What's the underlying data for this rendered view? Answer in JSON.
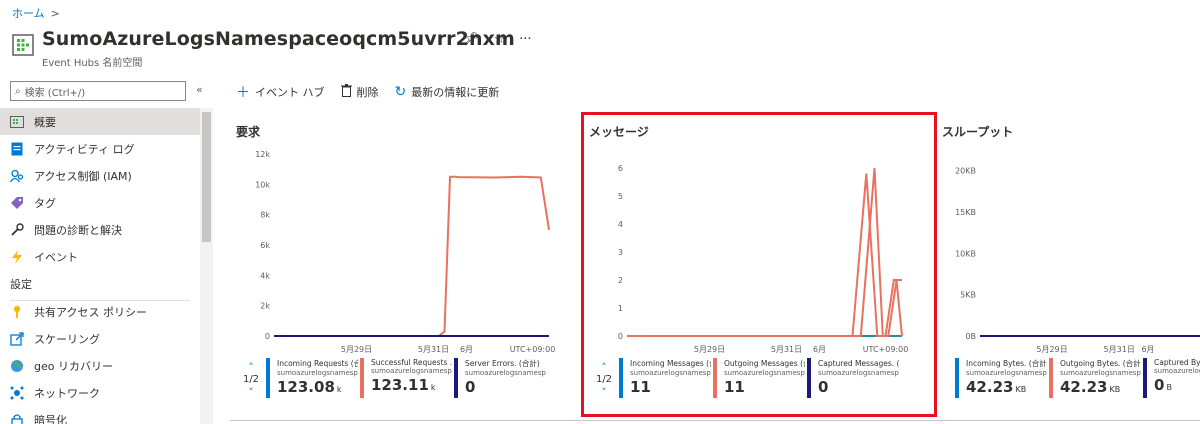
{
  "breadcrumb": {
    "home": "ホーム",
    "sep": ">"
  },
  "header": {
    "title": "SumoAzureLogsNamespaceoqcm5uvrr2nxm",
    "subtitle": "Event Hubs 名前空間",
    "pin": "✎",
    "star": "☆",
    "more": "···"
  },
  "sidebar": {
    "search_placeholder": "検索 (Ctrl+/)",
    "collapse": "«",
    "items": [
      {
        "label": "概要",
        "icon": "overview-icon"
      },
      {
        "label": "アクティビティ ログ",
        "icon": "activity-log-icon"
      },
      {
        "label": "アクセス制御 (IAM)",
        "icon": "iam-icon"
      },
      {
        "label": "タグ",
        "icon": "tag-icon"
      },
      {
        "label": "問題の診断と解決",
        "icon": "wrench-icon"
      },
      {
        "label": "イベント",
        "icon": "lightning-icon"
      }
    ],
    "section": "設定",
    "settings_items": [
      {
        "label": "共有アクセス ポリシー",
        "icon": "key-icon"
      },
      {
        "label": "スケーリング",
        "icon": "scale-icon"
      },
      {
        "label": "geo リカバリー",
        "icon": "globe-icon"
      },
      {
        "label": "ネットワーク",
        "icon": "network-icon"
      },
      {
        "label": "暗号化",
        "icon": "lock-icon"
      }
    ]
  },
  "toolbar": {
    "add_label": "イベント ハブ",
    "delete_label": "削除",
    "refresh_label": "最新の情報に更新"
  },
  "colors": {
    "accent": "#0078d4",
    "series_red": "#e8715f",
    "series_navy": "#1a1a7a",
    "series_teal": "#2a8a9a",
    "highlight": "#e81123"
  },
  "chart_data": [
    {
      "type": "line",
      "title": "要求",
      "x_ticks": [
        "5月29日",
        "5月31日",
        "6月",
        "UTC+09:00"
      ],
      "y_ticks": [
        "0",
        "2k",
        "4k",
        "6k",
        "8k",
        "10k",
        "12k"
      ],
      "ylim": [
        0,
        12000
      ],
      "series": [
        {
          "name": "Incoming Requests (合計)",
          "color": "#1a1a7a",
          "x": [
            0,
            62,
            63,
            64,
            67,
            100
          ],
          "y": [
            0,
            0,
            0,
            0,
            0,
            0
          ]
        },
        {
          "name": "Successful Requests (合計)",
          "color": "#e8715f",
          "x": [
            0,
            60,
            62,
            64,
            66,
            67,
            80,
            90,
            97,
            100
          ],
          "y": [
            0,
            0,
            300,
            10500,
            10500,
            10480,
            10450,
            10500,
            10450,
            7000
          ]
        },
        {
          "name": "Server Errors. (合計)",
          "color": "#1a1a7a",
          "x": [
            0,
            100
          ],
          "y": [
            0,
            0
          ]
        }
      ],
      "legend_page": "1/2",
      "legend": [
        {
          "l1": "Incoming Requests (合計)",
          "l2": "sumoazurelogsnamespa...",
          "value": "123.08",
          "unit": "k",
          "color": "#0078d4"
        },
        {
          "l1": "Successful Requests ...",
          "l2": "sumoazurelogsnamespa...",
          "value": "123.11",
          "unit": "k",
          "color": "#e8715f"
        },
        {
          "l1": "Server Errors. (合計)",
          "l2": "sumoazurelogsnamespa...",
          "value": "0",
          "unit": "",
          "color": "#1a1a7a"
        }
      ]
    },
    {
      "type": "line",
      "title": "メッセージ",
      "x_ticks": [
        "5月29日",
        "5月31日",
        "6月",
        "UTC+09:00"
      ],
      "y_ticks": [
        "0",
        "1",
        "2",
        "3",
        "4",
        "5",
        "6"
      ],
      "ylim": [
        0,
        6.5
      ],
      "series": [
        {
          "name": "Captured Messages. (合計)",
          "color": "#2a8a9a",
          "x": [
            0,
            100
          ],
          "y": [
            0,
            0
          ]
        },
        {
          "name": "Incoming Messages (合計)",
          "color": "#e8715f",
          "x": [
            0,
            80,
            85,
            90,
            93,
            95,
            98,
            100
          ],
          "y": [
            0,
            0,
            0,
            6,
            0,
            0,
            2,
            0
          ]
        },
        {
          "name": "Outgoing Messages (合計)",
          "color": "#e8715f",
          "x": [
            0,
            82,
            87,
            91,
            94,
            97,
            100
          ],
          "y": [
            0,
            0,
            5.8,
            0,
            0,
            2,
            2
          ]
        }
      ],
      "legend_page": "1/2",
      "legend": [
        {
          "l1": "Incoming Messages (合計)",
          "l2": "sumoazurelogsnamespa...",
          "value": "11",
          "unit": "",
          "color": "#0078d4"
        },
        {
          "l1": "Outgoing Messages (合計)",
          "l2": "sumoazurelogsnamespa...",
          "value": "11",
          "unit": "",
          "color": "#e8715f"
        },
        {
          "l1": "Captured Messages. (合計)",
          "l2": "sumoazurelogsnamespa...",
          "value": "0",
          "unit": "",
          "color": "#1a1a7a"
        }
      ]
    },
    {
      "type": "line",
      "title": "スループット",
      "x_ticks": [
        "5月29日",
        "5月31日",
        "6月"
      ],
      "y_ticks": [
        "0B",
        "5KB",
        "10KB",
        "15KB",
        "20KB"
      ],
      "ylim": [
        0,
        22000
      ],
      "series": [
        {
          "name": "Incoming Bytes. (合計)",
          "color": "#1a1a7a",
          "x": [
            0,
            100
          ],
          "y": [
            0,
            0
          ]
        }
      ],
      "legend": [
        {
          "l1": "Incoming Bytes. (合計)",
          "l2": "sumoazurelogsnamespa...",
          "value": "42.23",
          "unit": "KB",
          "color": "#0078d4"
        },
        {
          "l1": "Outgoing Bytes. (合計)",
          "l2": "sumoazurelogsnamespa...",
          "value": "42.23",
          "unit": "KB",
          "color": "#e8715f"
        },
        {
          "l1": "Captured Bytes",
          "l2": "sumoazurelogsnam...",
          "value": "0",
          "unit": "B",
          "color": "#1a1a7a"
        }
      ]
    }
  ]
}
